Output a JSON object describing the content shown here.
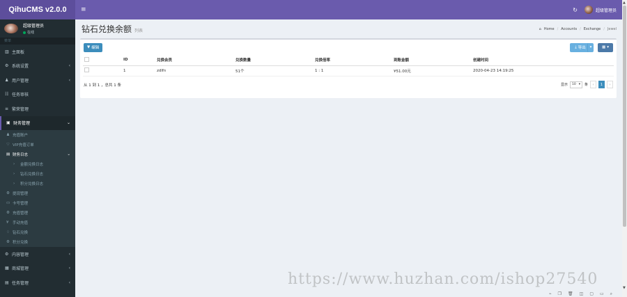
{
  "brand": "QihuCMS v2.0.0",
  "header": {
    "user_name": "超级管理员"
  },
  "sidebar": {
    "user_name": "超级管理员",
    "status": "在线",
    "nav_header": "菜单",
    "menu_top": [
      {
        "icon": "▥",
        "label": "主面板",
        "arrow": ""
      },
      {
        "icon": "⚙",
        "label": "系统设置",
        "arrow": "‹"
      },
      {
        "icon": "♟",
        "label": "用户管理",
        "arrow": "‹"
      },
      {
        "icon": "☷",
        "label": "任务审核",
        "arrow": ""
      },
      {
        "icon": "≡",
        "label": "繁荣管理",
        "arrow": ""
      }
    ],
    "open_menu": {
      "icon": "▣",
      "label": "财务管理",
      "arrow": "⌄"
    },
    "sub_items_a": [
      {
        "icon": "♟",
        "label": "充值账户"
      },
      {
        "icon": "♡",
        "label": "VIP充值订单"
      }
    ],
    "sub_open": {
      "icon": "▤",
      "label": "财务日志",
      "arrow": "⌄"
    },
    "sub_sub_items": [
      {
        "icon": "›",
        "label": "金额兑换日志"
      },
      {
        "icon": "›",
        "label": "钻石兑换日志"
      },
      {
        "icon": "›",
        "label": "积分兑换日志"
      }
    ],
    "sub_items_b": [
      {
        "icon": "⚙",
        "label": "提现管理"
      },
      {
        "icon": "▭",
        "label": "卡号管理"
      },
      {
        "icon": "⚙",
        "label": "充值管理"
      },
      {
        "icon": "¥",
        "label": "手动充值"
      },
      {
        "icon": "♢",
        "label": "钻石兑换"
      },
      {
        "icon": "⚙",
        "label": "积分兑换"
      }
    ],
    "menu_bottom": [
      {
        "icon": "⚙",
        "label": "内容管理",
        "arrow": "‹"
      },
      {
        "icon": "▦",
        "label": "商城管理",
        "arrow": "‹"
      },
      {
        "icon": "▤",
        "label": "任务管理",
        "arrow": "‹"
      }
    ]
  },
  "page": {
    "title": "钻石兑换余额",
    "subtitle": "列表",
    "breadcrumb": [
      "Home",
      "Accounts",
      "Exchange",
      "Jewel"
    ]
  },
  "toolbar": {
    "edit_label": "编辑",
    "export_label": "导出"
  },
  "table": {
    "columns": [
      "ID",
      "兑换会员",
      "兑换数量",
      "兑换倍率",
      "到账金额",
      "创建时间"
    ],
    "rows": [
      {
        "id": "1",
        "member": "zdlfn",
        "quantity": "51个",
        "rate": "1 : 1",
        "amount": "¥51.00元",
        "created": "2020-04-23 14:19:25"
      }
    ]
  },
  "pagination": {
    "summary": "从 1 到 1 ，总共 1 条",
    "per_label": "显示",
    "page_size": "10",
    "per_suffix": "条",
    "prev": "‹",
    "current": "1",
    "next": "›"
  },
  "watermark": "https://www.huzhan.com/ishop27540",
  "colors": {
    "brand_bg": "#5d4e9c",
    "navbar_bg": "#6a5bad",
    "sidebar_bg": "#222d32",
    "primary": "#3c8dbc"
  }
}
